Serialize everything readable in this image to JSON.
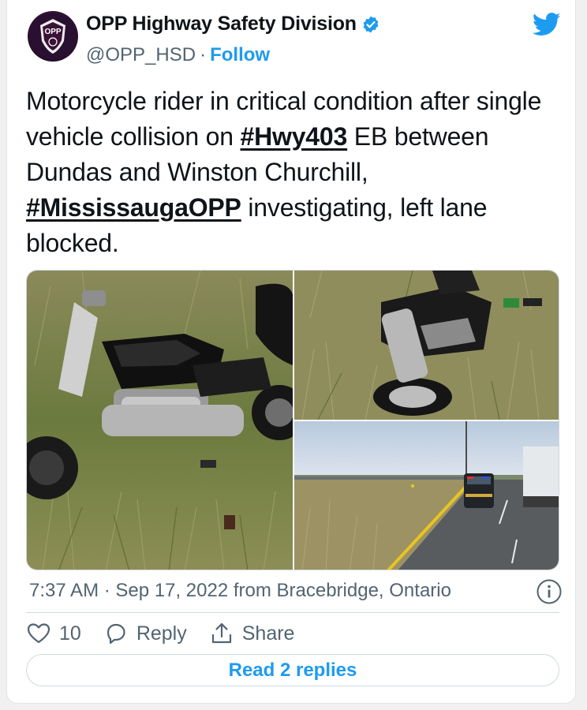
{
  "author": {
    "display_name": "OPP Highway Safety Division",
    "handle": "@OPP_HSD",
    "separator": "·",
    "follow_label": "Follow",
    "avatar_text": "OPP"
  },
  "tweet": {
    "text_1": "Motorcycle rider in critical condition after single vehicle collision on ",
    "hashtag_1": "#Hwy403",
    "text_2": " EB between Dundas and Winston Churchill, ",
    "hashtag_2": "#MississaugaOPP",
    "text_3": " investigating, left lane blocked."
  },
  "media": {
    "photos": [
      {
        "icon": "motorcycle-closeup-photo"
      },
      {
        "icon": "motorcycle-wreck-photo"
      },
      {
        "icon": "highway-police-scene-photo"
      }
    ]
  },
  "meta": {
    "timestamp": "7:37 AM · Sep 17, 2022 from Bracebridge, Ontario"
  },
  "actions": {
    "like_count": "10",
    "reply_label": "Reply",
    "share_label": "Share"
  },
  "read_replies_label": "Read 2 replies",
  "colors": {
    "accent": "#1d9bf0",
    "text": "#0f1419",
    "secondary": "#536471"
  }
}
